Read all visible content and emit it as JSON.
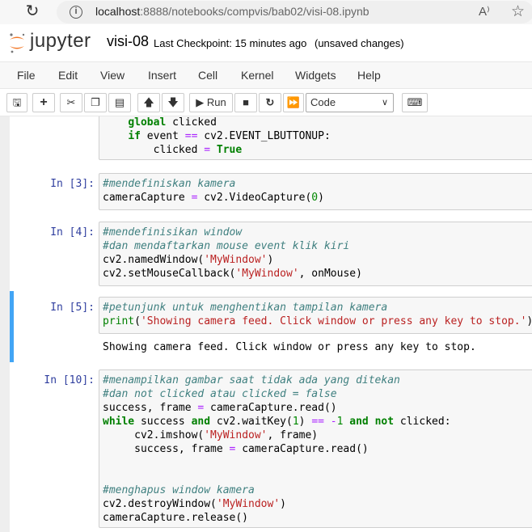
{
  "browser": {
    "url_prefix": "localhost",
    "url_rest": ":8888/notebooks/compvis/bab02/visi-08.ipynb"
  },
  "header": {
    "logo_text": "jupyter",
    "notebook_name": "visi-08",
    "checkpoint": "Last Checkpoint: 15 minutes ago",
    "unsaved": "(unsaved changes)"
  },
  "menu": [
    "File",
    "Edit",
    "View",
    "Insert",
    "Cell",
    "Kernel",
    "Widgets",
    "Help"
  ],
  "toolbar": {
    "run_label": "Run",
    "cell_type": "Code"
  },
  "cells": [
    {
      "prompt": "",
      "lines": [
        [
          {
            "t": "    "
          },
          {
            "t": "global",
            "c": "kw"
          },
          {
            "t": " clicked"
          }
        ],
        [
          {
            "t": "    "
          },
          {
            "t": "if",
            "c": "kw"
          },
          {
            "t": " event "
          },
          {
            "t": "==",
            "c": "op"
          },
          {
            "t": " cv2.EVENT_LBUTTONUP:"
          }
        ],
        [
          {
            "t": "        clicked "
          },
          {
            "t": "=",
            "c": "op"
          },
          {
            "t": " "
          },
          {
            "t": "True",
            "c": "kw"
          }
        ]
      ]
    },
    {
      "prompt": "In [3]:",
      "lines": [
        [
          {
            "t": "#mendefiniskan kamera",
            "c": "cm"
          }
        ],
        [
          {
            "t": "cameraCapture "
          },
          {
            "t": "=",
            "c": "op"
          },
          {
            "t": " cv2.VideoCapture("
          },
          {
            "t": "0",
            "c": "num"
          },
          {
            "t": ")"
          }
        ]
      ]
    },
    {
      "prompt": "In [4]:",
      "lines": [
        [
          {
            "t": "#mendefinisikan window",
            "c": "cm"
          }
        ],
        [
          {
            "t": "#dan mendaftarkan mouse event klik kiri",
            "c": "cm"
          }
        ],
        [
          {
            "t": "cv2.namedWindow("
          },
          {
            "t": "'MyWindow'",
            "c": "str"
          },
          {
            "t": ")"
          }
        ],
        [
          {
            "t": "cv2.setMouseCallback("
          },
          {
            "t": "'MyWindow'",
            "c": "str"
          },
          {
            "t": ", onMouse)"
          }
        ]
      ]
    },
    {
      "prompt": "In [5]:",
      "lines": [
        [
          {
            "t": "#petunjunk untuk menghentikan tampilan kamera",
            "c": "cm"
          }
        ],
        [
          {
            "t": "print",
            "c": "kw2"
          },
          {
            "t": "("
          },
          {
            "t": "'Showing camera feed. Click window or press any key to stop.'",
            "c": "str"
          },
          {
            "t": ")"
          }
        ]
      ],
      "output": "Showing camera feed. Click window or press any key to stop."
    },
    {
      "prompt": "In [10]:",
      "lines": [
        [
          {
            "t": "#menampilkan gambar saat tidak ada yang ditekan",
            "c": "cm"
          }
        ],
        [
          {
            "t": "#dan not clicked atau clicked = false",
            "c": "cm"
          }
        ],
        [
          {
            "t": "success, frame "
          },
          {
            "t": "=",
            "c": "op"
          },
          {
            "t": " cameraCapture.read()"
          }
        ],
        [
          {
            "t": "while",
            "c": "kw"
          },
          {
            "t": " success "
          },
          {
            "t": "and",
            "c": "kw"
          },
          {
            "t": " cv2.waitKey("
          },
          {
            "t": "1",
            "c": "num"
          },
          {
            "t": ") "
          },
          {
            "t": "==",
            "c": "op"
          },
          {
            "t": " "
          },
          {
            "t": "-",
            "c": "op"
          },
          {
            "t": "1",
            "c": "num"
          },
          {
            "t": " "
          },
          {
            "t": "and",
            "c": "kw"
          },
          {
            "t": " "
          },
          {
            "t": "not",
            "c": "kw"
          },
          {
            "t": " clicked:"
          }
        ],
        [
          {
            "t": "     cv2.imshow("
          },
          {
            "t": "'MyWindow'",
            "c": "str"
          },
          {
            "t": ", frame)"
          }
        ],
        [
          {
            "t": "     success, frame "
          },
          {
            "t": "=",
            "c": "op"
          },
          {
            "t": " cameraCapture.read()"
          }
        ],
        [
          {
            "t": ""
          }
        ],
        [
          {
            "t": ""
          }
        ],
        [
          {
            "t": "#menghapus window kamera",
            "c": "cm"
          }
        ],
        [
          {
            "t": "cv2.destroyWindow("
          },
          {
            "t": "'MyWindow'",
            "c": "str"
          },
          {
            "t": ")"
          }
        ],
        [
          {
            "t": "cameraCapture.release()"
          }
        ]
      ]
    }
  ]
}
